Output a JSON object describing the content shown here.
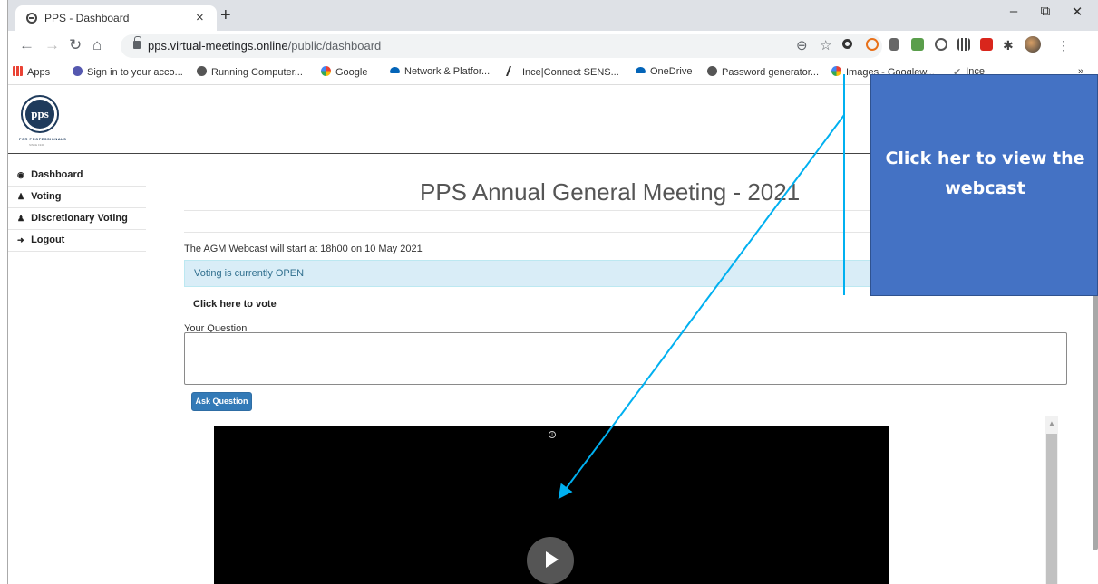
{
  "browser": {
    "tab_title": "PPS - Dashboard",
    "tab_close": "×",
    "new_tab": "+",
    "minimize": "–",
    "restore": "⧉",
    "close": "✕",
    "url_host": "pps.virtual-meetings.online",
    "url_path": "/public/dashboard",
    "bookmarks": [
      {
        "label": "Apps",
        "icon": "apps-grid-icon",
        "color": "#4285f4"
      },
      {
        "label": "Sign in to your acco...",
        "icon": "teams-icon",
        "color": "#5558af"
      },
      {
        "label": "Running Computer...",
        "icon": "globe-icon",
        "color": "#555555"
      },
      {
        "label": "Google",
        "icon": "google-icon",
        "color": "#4285f4"
      },
      {
        "label": "Network & Platfor...",
        "icon": "onedrive-icon",
        "color": "#0364b8"
      },
      {
        "label": "Ince|Connect SENS...",
        "icon": "ince-icon",
        "color": "#333333"
      },
      {
        "label": "OneDrive",
        "icon": "onedrive-icon",
        "color": "#0364b8"
      },
      {
        "label": "Password generator...",
        "icon": "globe-icon",
        "color": "#555555"
      },
      {
        "label": "Images - Googlew...",
        "icon": "google-icon",
        "color": "#4285f4"
      },
      {
        "label": "Ince",
        "icon": "ince-check-icon",
        "color": "#7f7f7f"
      },
      {
        "label": "»",
        "icon": "",
        "color": "#333333"
      }
    ]
  },
  "site": {
    "logo_text": "pps",
    "logo_subtitle": "FOR PROFESSIONALS",
    "logo_since": "SINCE 1941",
    "sidebar": [
      {
        "label": "Dashboard",
        "icon": "dashboard-icon",
        "glyph": "◉"
      },
      {
        "label": "Voting",
        "icon": "user-icon",
        "glyph": "♟"
      },
      {
        "label": "Discretionary Voting",
        "icon": "users-icon",
        "glyph": "♟"
      },
      {
        "label": "Logout",
        "icon": "logout-icon",
        "glyph": "➜"
      }
    ],
    "title": "PPS Annual General Meeting - 2021",
    "webcast_start": "The AGM Webcast will start at 18h00 on 10 May 2021",
    "voting_status": "Voting is currently OPEN",
    "vote_link": "Click here to vote",
    "question_label": "Your Question",
    "question_value": "",
    "ask_button": "Ask Question"
  },
  "annotation": {
    "callout_text": "Click her to view the webcast",
    "fill": "#4472c4",
    "arrow_color": "#00b0f0"
  }
}
